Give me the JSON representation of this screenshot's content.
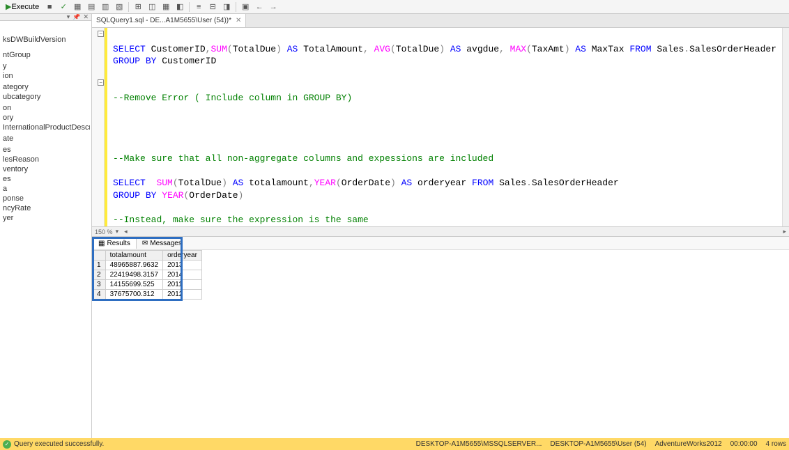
{
  "toolbar": {
    "execute": "Execute"
  },
  "tab": {
    "title": "SQLQuery1.sql - DE...A1M5655\\User (54))*"
  },
  "tree": {
    "items": [
      "",
      "",
      "",
      "",
      "",
      "",
      "",
      "",
      "",
      "ksDWBuildVersion",
      "",
      "",
      "",
      "",
      "ntGroup",
      "",
      "y",
      "ion",
      "",
      "ategory",
      "ubcategory",
      "",
      "on",
      "ory",
      "InternationalProductDescription",
      "",
      "ate",
      "",
      "es",
      "lesReason",
      "ventory",
      "es",
      "a",
      "ponse",
      "ncyRate",
      "yer"
    ]
  },
  "code": {
    "line1a": "SELECT",
    "line1b": " CustomerID",
    "line1c": ",",
    "line1d": "SUM",
    "line1e": "(",
    "line1f": "TotalDue",
    "line1g": ")",
    "line1h": " AS",
    "line1i": " TotalAmount",
    "line1j": ", ",
    "line1k": "AVG",
    "line1l": "(",
    "line1m": "TotalDue",
    "line1n": ")",
    "line1o": " AS",
    "line1p": " avgdue",
    "line1q": ", ",
    "line1r": "MAX",
    "line1s": "(",
    "line1t": "TaxAmt",
    "line1u": ")",
    "line1v": " AS",
    "line1w": " MaxTax ",
    "line1x": "FROM",
    "line1y": " Sales",
    "line1z": ".",
    "line1aa": "SalesOrderHeader",
    "line2a": "GROUP BY",
    "line2b": " CustomerID",
    "line5": "--Remove Error ( Include column in GROUP BY)",
    "line10": "--Make sure that all non-aggregate columns and expessions are included",
    "line12a": "SELECT",
    "line12b": "  ",
    "line12c": "SUM",
    "line12d": "(",
    "line12e": "TotalDue",
    "line12f": ")",
    "line12g": " AS",
    "line12h": " totalamount",
    "line12i": ",",
    "line12j": "YEAR",
    "line12k": "(",
    "line12l": "OrderDate",
    "line12m": ")",
    "line12n": " AS",
    "line12o": " orderyear ",
    "line12p": "FROM",
    "line12q": " Sales",
    "line12r": ".",
    "line12s": "SalesOrderHeader",
    "line13a": "GROUP BY",
    "line13b": " ",
    "line13c": "YEAR",
    "line13d": "(",
    "line13e": "OrderDate",
    "line13f": ")",
    "line15": "--Instead, make sure the expression is the same"
  },
  "zoom": "150 %",
  "results": {
    "tab_results": "Results",
    "tab_messages": "Messages",
    "headers": [
      "",
      "totalamount",
      "orderyear"
    ],
    "rows": [
      [
        "1",
        "48965887.9632",
        "2013"
      ],
      [
        "2",
        "22419498.3157",
        "2014"
      ],
      [
        "3",
        "14155699.525",
        "2011"
      ],
      [
        "4",
        "37675700.312",
        "2012"
      ]
    ]
  },
  "status": {
    "message": "Query executed successfully.",
    "server": "DESKTOP-A1M5655\\MSSQLSERVER...",
    "user": "DESKTOP-A1M5655\\User (54)",
    "db": "AdventureWorks2012",
    "time": "00:00:00",
    "rows": "4 rows"
  }
}
